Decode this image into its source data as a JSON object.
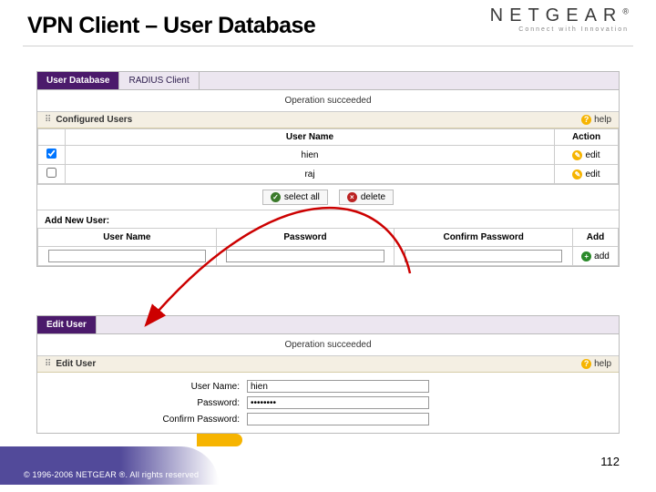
{
  "slide": {
    "title": "VPN Client – User Database",
    "brand_name": "NETGEAR",
    "brand_tag": "Connect with Innovation",
    "page_number": "112",
    "copyright": "© 1996-2006 NETGEAR ®.   All rights reserved"
  },
  "top_panel": {
    "tabs": [
      "User Database",
      "RADIUS Client"
    ],
    "active_tab": 0,
    "status": "Operation succeeded",
    "section_title": "Configured Users",
    "help_label": "help",
    "columns": {
      "user": "User Name",
      "action": "Action"
    },
    "rows": [
      {
        "checked": true,
        "user": "hien",
        "action_label": "edit"
      },
      {
        "checked": false,
        "user": "raj",
        "action_label": "edit"
      }
    ],
    "buttons": {
      "select_all": "select all",
      "delete": "delete"
    },
    "add_section": {
      "title": "Add New User:",
      "cols": {
        "user": "User Name",
        "pass": "Password",
        "confirm": "Confirm Password",
        "add": "Add"
      },
      "values": {
        "user": "",
        "pass": "",
        "confirm": ""
      },
      "add_label": "add"
    }
  },
  "bottom_panel": {
    "tab_label": "Edit User",
    "status": "Operation succeeded",
    "section_title": "Edit User",
    "help_label": "help",
    "fields": {
      "user_label": "User Name:",
      "user_value": "hien",
      "pass_label": "Password:",
      "pass_value": "••••••••",
      "confirm_label": "Confirm Password:",
      "confirm_value": ""
    }
  }
}
